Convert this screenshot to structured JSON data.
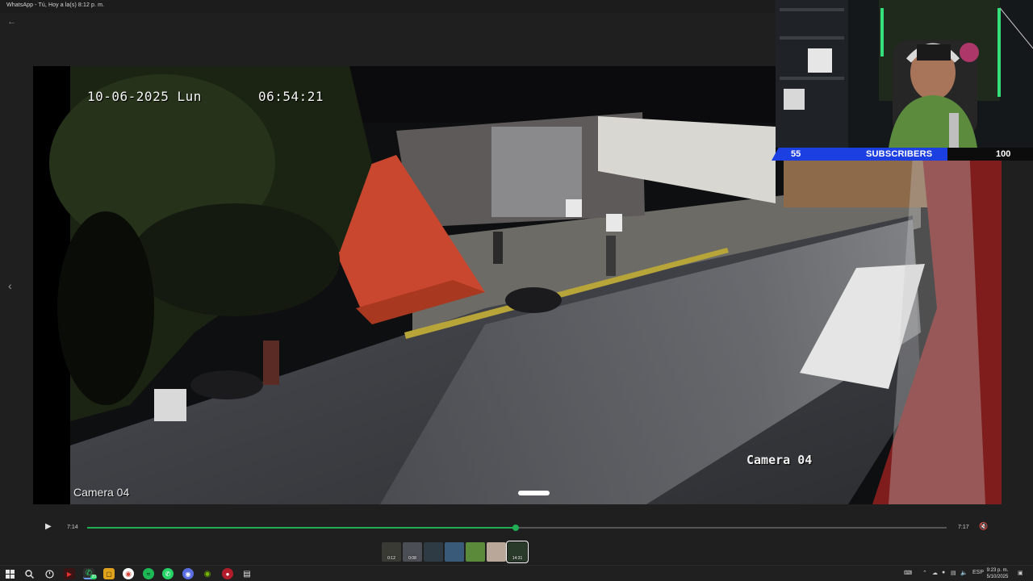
{
  "window": {
    "title": "WhatsApp - Tú, Hoy a la(s) 8:12 p. m."
  },
  "video": {
    "date": "10-06-2025 Lun",
    "time": "06:54:21",
    "camera_left": "Camera 04",
    "camera_right": "Camera 04"
  },
  "overlay": {
    "subs_current": "55",
    "subs_label": "SUBSCRIBERS",
    "subs_goal": "100",
    "accent": "#1b3fe0"
  },
  "player": {
    "current_time": "7:14",
    "duration": "7:17",
    "progress": 0.499,
    "accent": "#1fae54"
  },
  "thumbnails": [
    {
      "duration": "0:12",
      "color": "#3a3a34"
    },
    {
      "duration": "0:08",
      "color": "#4b4e55"
    },
    {
      "duration": "",
      "color": "#2e3a44"
    },
    {
      "duration": "",
      "color": "#3a5a7a"
    },
    {
      "duration": "",
      "color": "#5a8a3a"
    },
    {
      "duration": "",
      "color": "#b9a89a"
    },
    {
      "duration": "14:31",
      "color": "#2a3a2a"
    }
  ],
  "taskbar": {
    "whatsapp_badge": "20",
    "language": "ESP",
    "clock_time": "9:23 p. m.",
    "clock_date": "5/10/2025"
  }
}
